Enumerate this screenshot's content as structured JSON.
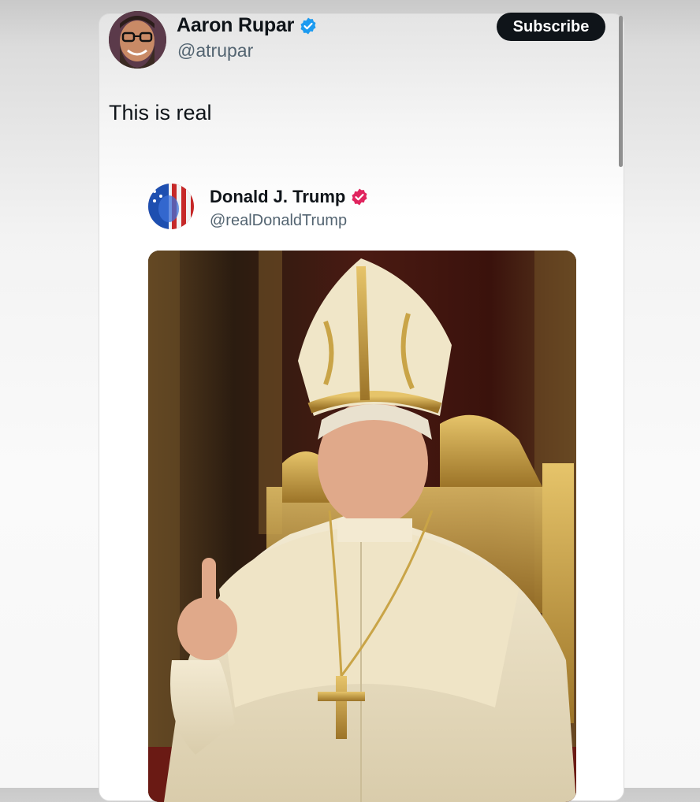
{
  "tweet": {
    "author_name": "Aaron Rupar",
    "author_handle": "@atrupar",
    "subscribe_label": "Subscribe",
    "text": "This is real"
  },
  "quoted": {
    "author_name": "Donald J. Trump",
    "author_handle": "@realDonaldTrump"
  },
  "colors": {
    "verified_blue": "#1d9bf0",
    "verified_pink": "#e0245e",
    "subscribe_bg": "#0f1419"
  },
  "icons": [
    "verified-badge-icon"
  ]
}
